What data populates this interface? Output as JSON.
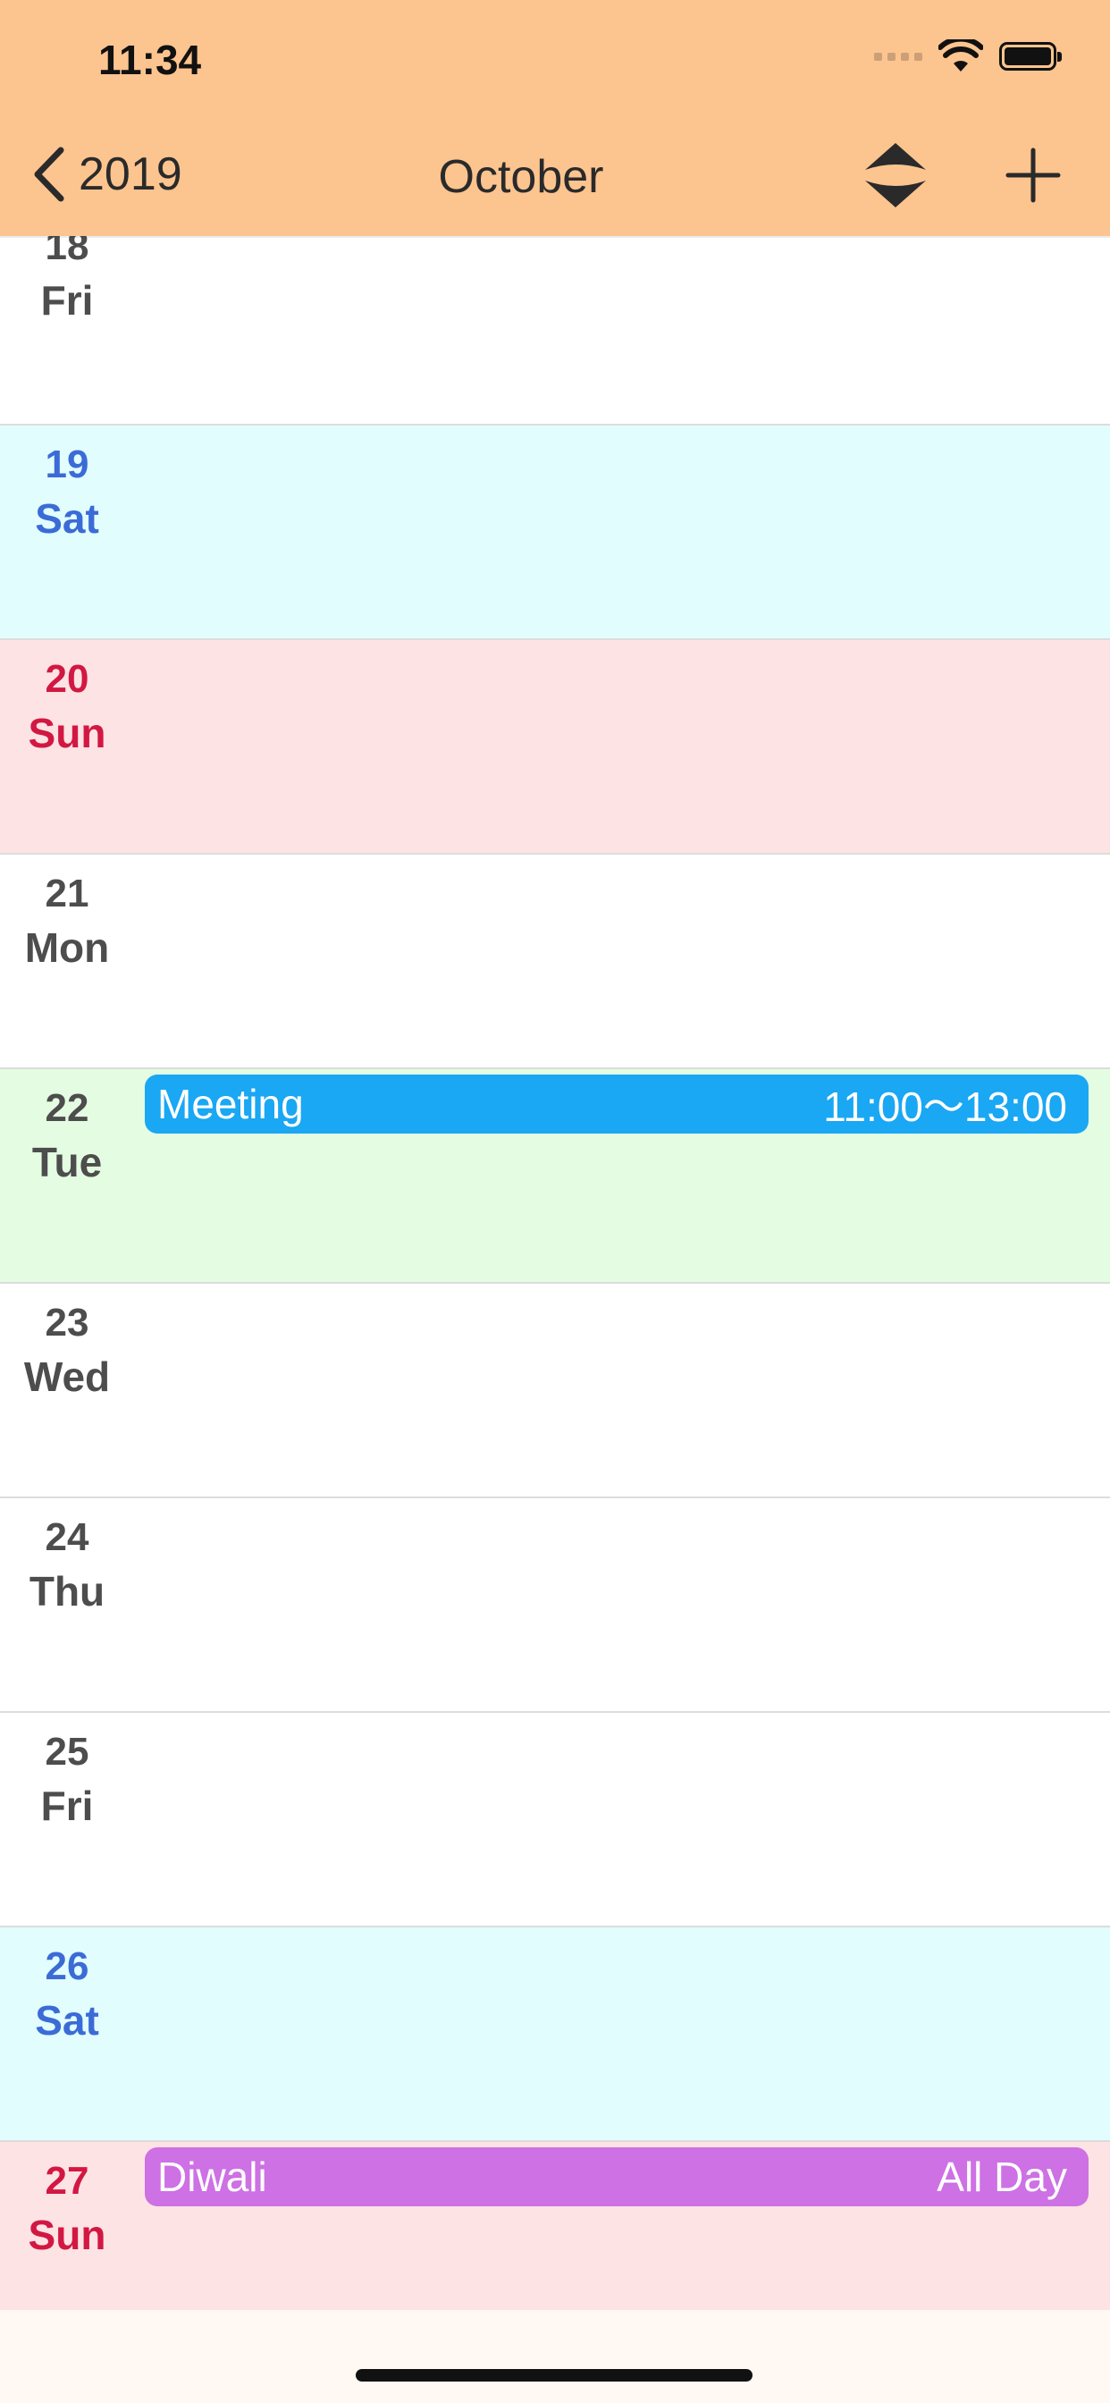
{
  "status_bar": {
    "time": "11:34"
  },
  "nav": {
    "back_label": "2019",
    "title": "October",
    "sort_icon": "up-down-chevrons-icon",
    "add_icon": "plus-icon"
  },
  "days": [
    {
      "num": "18",
      "name": "Fri"
    },
    {
      "num": "19",
      "name": "Sat"
    },
    {
      "num": "20",
      "name": "Sun"
    },
    {
      "num": "21",
      "name": "Mon"
    },
    {
      "num": "22",
      "name": "Tue"
    },
    {
      "num": "23",
      "name": "Wed"
    },
    {
      "num": "24",
      "name": "Thu"
    },
    {
      "num": "25",
      "name": "Fri"
    },
    {
      "num": "26",
      "name": "Sat"
    },
    {
      "num": "27",
      "name": "Sun"
    }
  ],
  "events": [
    {
      "title": "Meeting",
      "time": "11:00～13:00"
    },
    {
      "title": "Diwali",
      "time": "All Day"
    }
  ],
  "colors": {
    "header_bg": "#fcc48f",
    "saturday": "#3b6bd6",
    "sunday": "#d21842",
    "saturday_bg": "#e2fdfe",
    "sunday_bg": "#fee3e4",
    "today_bg": "#e4fde2",
    "meeting_event": "#1aa7f3",
    "holiday_event": "#cd71e4"
  }
}
